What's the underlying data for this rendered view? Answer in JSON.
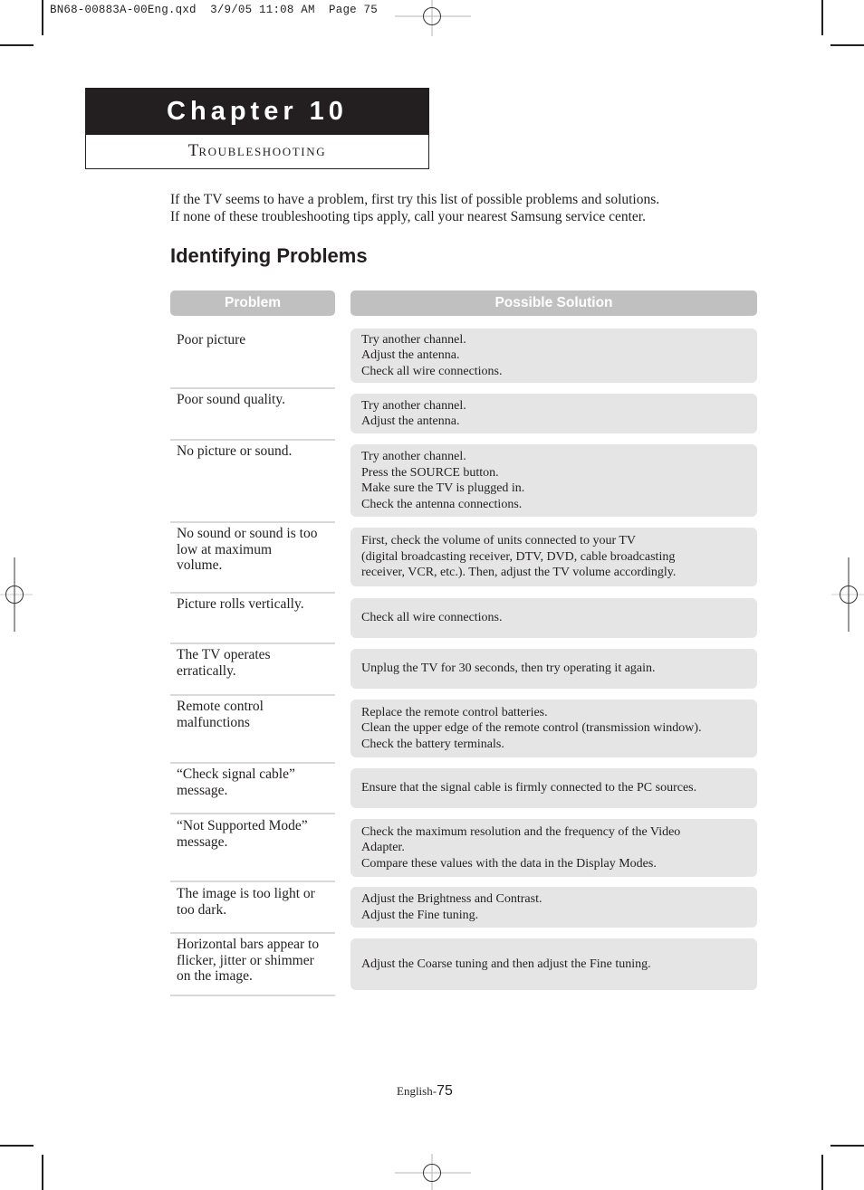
{
  "print_slug": "BN68-00883A-00Eng.qxd  3/9/05 11:08 AM  Page 75",
  "chapter": {
    "title": "Chapter 10",
    "subtitle_initial": "T",
    "subtitle_rest": "ROUBLESHOOTING"
  },
  "intro": {
    "line1": "If the TV seems to have a problem, first try this list of possible problems and solutions.",
    "line2": "If none of these troubleshooting tips apply, call your nearest Samsung service center."
  },
  "section_title": "Identifying Problems",
  "table": {
    "headers": {
      "problem": "Problem",
      "solution": "Possible Solution"
    },
    "rows": [
      {
        "problem": [
          "Poor picture"
        ],
        "solution": [
          "Try another channel.",
          "Adjust the antenna.",
          "Check all wire connections."
        ]
      },
      {
        "problem": [
          "Poor sound quality."
        ],
        "solution": [
          "Try another channel.",
          "Adjust the antenna."
        ]
      },
      {
        "problem": [
          "No picture or sound."
        ],
        "solution": [
          "Try another channel.",
          "Press the SOURCE button.",
          "Make sure the TV is plugged in.",
          "Check the antenna connections."
        ]
      },
      {
        "problem": [
          "No sound or sound is too",
          "low at maximum",
          "volume."
        ],
        "solution": [
          "First, check the volume of units connected to your TV",
          "(digital broadcasting receiver, DTV, DVD, cable broadcasting",
          "receiver, VCR, etc.). Then, adjust the TV volume accordingly."
        ]
      },
      {
        "problem": [
          "Picture rolls vertically."
        ],
        "solution": [
          "Check all wire connections."
        ]
      },
      {
        "problem": [
          "The TV operates",
          "erratically."
        ],
        "solution": [
          "Unplug the TV for 30 seconds, then try operating it again."
        ]
      },
      {
        "problem": [
          "Remote control",
          "malfunctions"
        ],
        "solution": [
          "Replace the remote control batteries.",
          "Clean the upper edge of the remote control (transmission window).",
          "Check the battery terminals."
        ]
      },
      {
        "problem": [
          "“Check signal cable”",
          "message."
        ],
        "solution": [
          "Ensure that the signal cable is firmly connected to the PC sources."
        ]
      },
      {
        "problem": [
          "“Not Supported Mode”",
          "message."
        ],
        "solution": [
          "Check the maximum resolution and the frequency of the Video",
          "Adapter.",
          "Compare these values with the data in the Display Modes."
        ]
      },
      {
        "problem": [
          "The image is too light or",
          "too dark."
        ],
        "solution": [
          "Adjust the Brightness and Contrast.",
          "Adjust the Fine tuning."
        ]
      },
      {
        "problem": [
          "Horizontal bars appear to",
          "flicker, jitter or shimmer",
          "on the image."
        ],
        "solution": [
          "Adjust the Coarse tuning and then adjust the Fine tuning."
        ]
      }
    ]
  },
  "footer": {
    "label": "English-",
    "page_number": "75"
  }
}
